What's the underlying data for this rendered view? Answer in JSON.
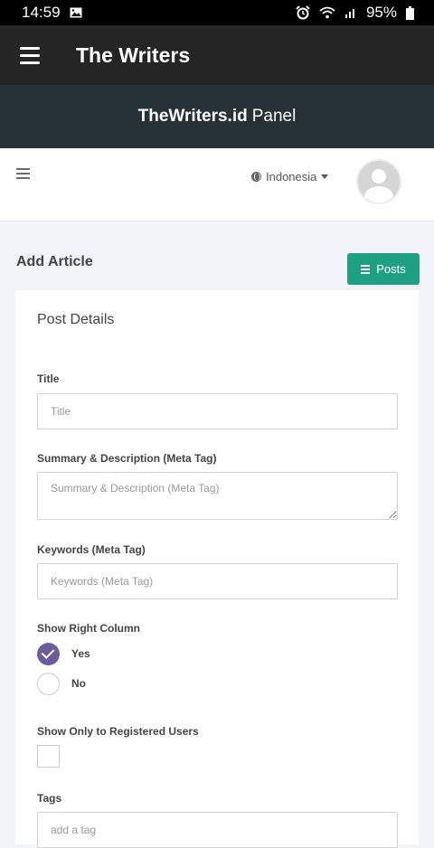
{
  "status_bar": {
    "time": "14:59",
    "battery": "95%"
  },
  "app": {
    "title": "The Writers"
  },
  "panel": {
    "brand": "TheWriters.id",
    "label": "Panel"
  },
  "topbar": {
    "language": "Indonesia"
  },
  "page": {
    "title": "Add Article",
    "posts_button": "Posts"
  },
  "form": {
    "section_title": "Post Details",
    "title_label": "Title",
    "title_placeholder": "Title",
    "summary_label": "Summary & Description (Meta Tag)",
    "summary_placeholder": "Summary & Description (Meta Tag)",
    "keywords_label": "Keywords (Meta Tag)",
    "keywords_placeholder": "Keywords (Meta Tag)",
    "right_column_label": "Show Right Column",
    "option_yes": "Yes",
    "option_no": "No",
    "registered_label": "Show Only to Registered Users",
    "tags_label": "Tags",
    "tags_placeholder": "add a tag"
  }
}
